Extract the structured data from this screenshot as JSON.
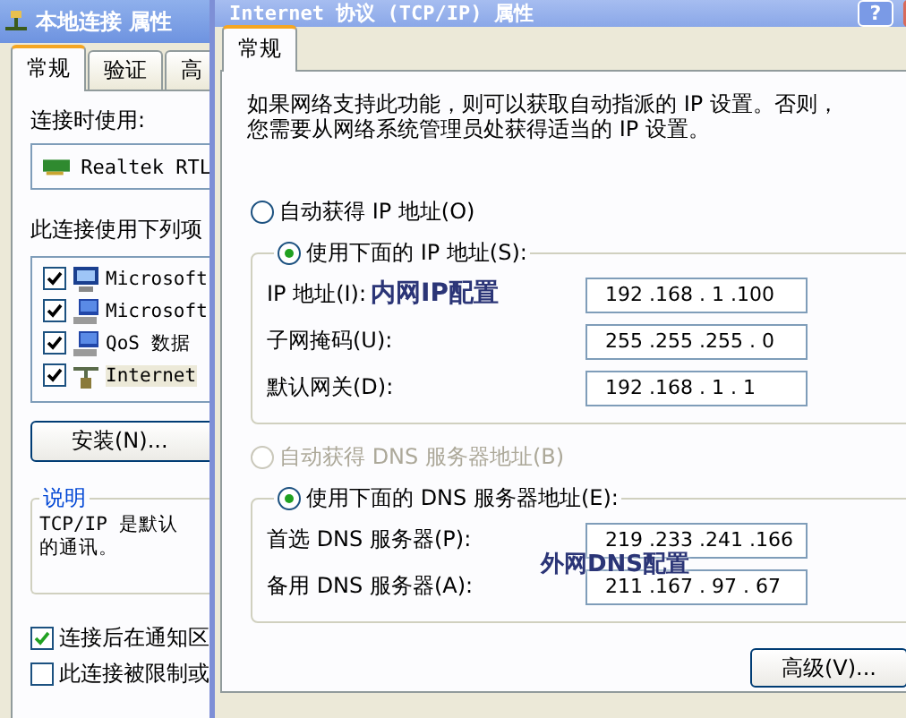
{
  "back_window": {
    "title": "本地连接 属性",
    "tabs": [
      {
        "label": "常规",
        "selected": true
      },
      {
        "label": "验证",
        "selected": false
      },
      {
        "label": "高",
        "selected": false
      }
    ],
    "connect_using_label": "连接时使用:",
    "adapter": "Realtek RTL",
    "components_label": "此连接使用下列项",
    "components": [
      {
        "name": "Microsoft",
        "kind": "client",
        "checked": true
      },
      {
        "name": "Microsoft",
        "kind": "service",
        "checked": true
      },
      {
        "name": "QoS 数据",
        "kind": "service",
        "checked": true
      },
      {
        "name": "Internet",
        "kind": "protocol",
        "checked": true,
        "selected": true
      }
    ],
    "install_button": "安装(N)...",
    "description": {
      "legend": "说明",
      "lines": [
        "TCP/IP 是默认",
        "的通讯。"
      ]
    },
    "options": [
      {
        "label": "连接后在通知区",
        "checked": true
      },
      {
        "label": "此连接被限制或",
        "checked": false
      }
    ]
  },
  "dialog": {
    "title": "Internet 协议 (TCP/IP) 属性",
    "help_button": "?",
    "tabs": [
      {
        "label": "常规",
        "selected": true
      }
    ],
    "intro": [
      "如果网络支持此功能，则可以获取自动指派的 IP 设置。否则，",
      "您需要从网络系统管理员处获得适当的 IP 设置。"
    ],
    "ip_options": [
      {
        "label": "自动获得 IP 地址(O)",
        "selected": false,
        "disabled": false
      },
      {
        "label": "使用下面的 IP 地址(S):",
        "selected": true,
        "disabled": false,
        "fields": [
          {
            "label": "IP 地址(I):",
            "value": "192 .168 . 1 .100",
            "overlay": "内网IP配置"
          },
          {
            "label": "子网掩码(U):",
            "value": "255 .255 .255 . 0"
          },
          {
            "label": "默认网关(D):",
            "value": "192 .168 . 1 . 1"
          }
        ]
      }
    ],
    "dns_options": [
      {
        "label": "自动获得 DNS 服务器地址(B)",
        "selected": false,
        "disabled": true
      },
      {
        "label": "使用下面的 DNS 服务器地址(E):",
        "selected": true,
        "disabled": false,
        "fields": [
          {
            "label": "首选 DNS 服务器(P):",
            "value": "219 .233 .241 .166",
            "overlay": "外网DNS配置"
          },
          {
            "label": "备用 DNS 服务器(A):",
            "value": "211 .167 . 97 . 67"
          }
        ]
      }
    ],
    "advanced_button": "高级(V)..."
  }
}
